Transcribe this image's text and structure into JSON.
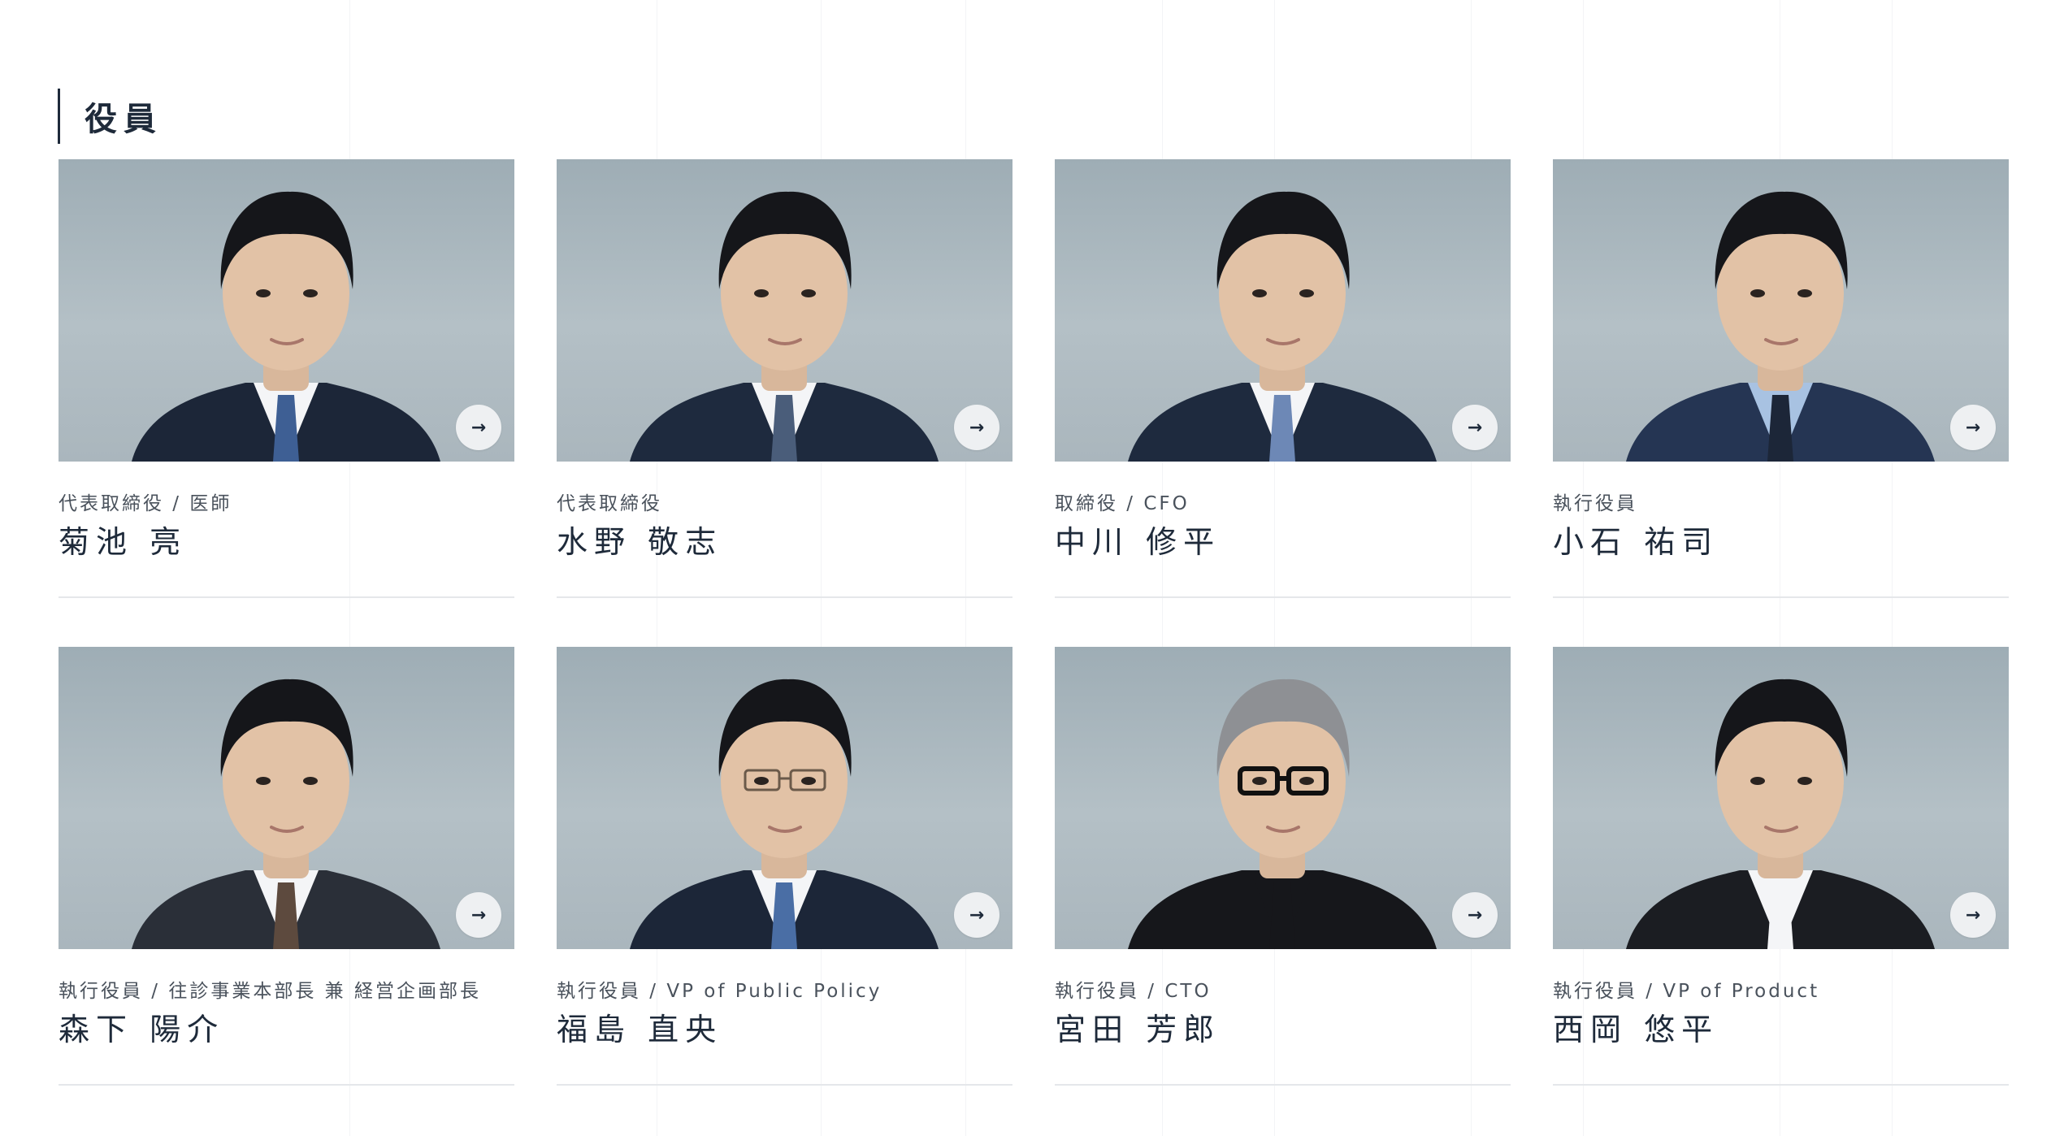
{
  "section": {
    "title": "役員"
  },
  "arrow_glyph": "→",
  "colors": {
    "text": "#1e2a3a",
    "photo_bg": "#a9b6bd",
    "divider": "#e5e7ea"
  },
  "members": [
    {
      "role": "代表取締役 / 医師",
      "name": "菊池 亮",
      "hair": "#15161a",
      "suit": "#1c2638",
      "tie": "#3e5f94",
      "shirt": "#f4f5f7"
    },
    {
      "role": "代表取締役",
      "name": "水野 敬志",
      "hair": "#15161a",
      "suit": "#1e2a3e",
      "tie": "#4a5d7a",
      "shirt": "#f4f5f7"
    },
    {
      "role": "取締役 / CFO",
      "name": "中川 修平",
      "hair": "#15161a",
      "suit": "#1e2a3e",
      "tie": "#6d88b6",
      "shirt": "#f4f5f7"
    },
    {
      "role": "執行役員",
      "name": "小石 祐司",
      "hair": "#15161a",
      "suit": "#253553",
      "tie": "#1c2638",
      "shirt": "#a8c2e2"
    },
    {
      "role": "執行役員 / 往診事業本部長 兼 経営企画部長",
      "name": "森下 陽介",
      "hair": "#15161a",
      "suit": "#2a2f38",
      "tie": "#5d4a3e",
      "shirt": "#f4f5f7"
    },
    {
      "role": "執行役員 / VP of Public Policy",
      "name": "福島 直央",
      "hair": "#15161a",
      "suit": "#1c2638",
      "tie": "#4a6ea5",
      "shirt": "#f4f5f7"
    },
    {
      "role": "執行役員 / CTO",
      "name": "宮田 芳郎",
      "hair": "#8e9094",
      "suit": "#16171b",
      "tie": "#16171b",
      "shirt": "#16171b"
    },
    {
      "role": "執行役員 / VP of Product",
      "name": "西岡 悠平",
      "hair": "#15161a",
      "suit": "#1b1d22",
      "tie": "#f4f5f7",
      "shirt": "#f4f5f7"
    }
  ]
}
